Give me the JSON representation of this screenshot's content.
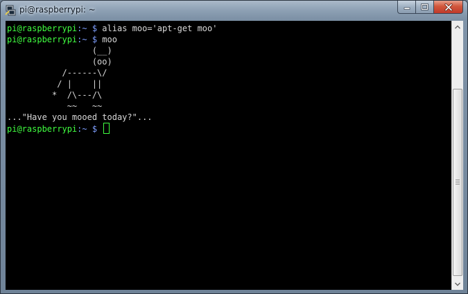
{
  "window": {
    "title": "pi@raspberrypi: ~",
    "icon": "putty-icon",
    "buttons": [
      "minimize-icon",
      "maximize-icon",
      "close-icon"
    ]
  },
  "terminal": {
    "prompt_user": "pi@raspberrypi",
    "prompt_sep": ":",
    "prompt_path": "~",
    "prompt_symbol": "$",
    "lines": [
      {
        "type": "prompt",
        "command": "alias moo='apt-get moo'"
      },
      {
        "type": "prompt",
        "command": "moo"
      },
      {
        "type": "output",
        "text": "                 (__)"
      },
      {
        "type": "output",
        "text": "                 (oo)"
      },
      {
        "type": "output",
        "text": "           /------\\/"
      },
      {
        "type": "output",
        "text": "          / |    ||"
      },
      {
        "type": "output",
        "text": "         *  /\\---/\\"
      },
      {
        "type": "output",
        "text": "            ~~   ~~"
      },
      {
        "type": "output",
        "text": "...\"Have you mooed today?\"..."
      },
      {
        "type": "prompt",
        "command": ""
      }
    ],
    "colors": {
      "background": "#000000",
      "text": "#d8d8d8",
      "prompt_user": "#40ff40",
      "prompt_path": "#7f9fff",
      "cursor": "#40ff40"
    }
  }
}
